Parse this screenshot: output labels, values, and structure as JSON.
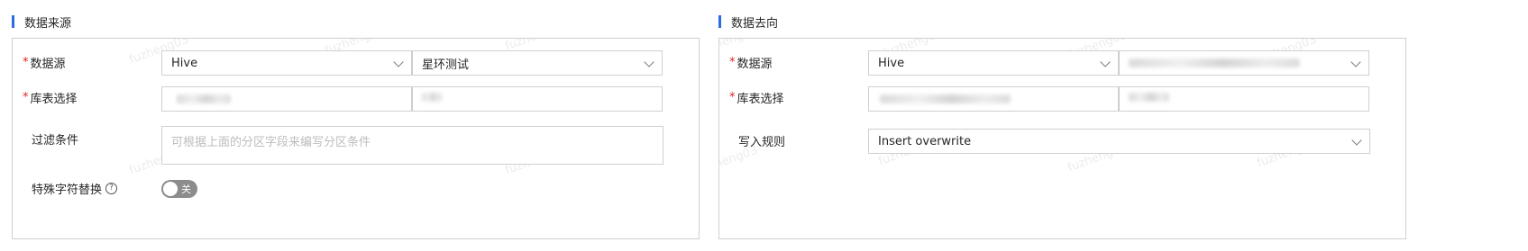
{
  "source": {
    "title": "数据来源",
    "datasource_label": "数据源",
    "datasource_type": "Hive",
    "datasource_name": "星环测试",
    "table_label": "库表选择",
    "filter_label": "过滤条件",
    "filter_placeholder": "可根据上面的分区字段来编写分区条件",
    "special_char_label": "特殊字符替换",
    "special_char_toggle": "关"
  },
  "target": {
    "title": "数据去向",
    "datasource_label": "数据源",
    "datasource_type": "Hive",
    "table_label": "库表选择",
    "write_rule_label": "写入规则",
    "write_rule_value": "Insert overwrite"
  },
  "required_mark": "*",
  "watermark": "fuzheng03",
  "colors": {
    "accent": "#2d6cdf",
    "required": "#e02424",
    "toggle_off": "#8c8c8c"
  }
}
